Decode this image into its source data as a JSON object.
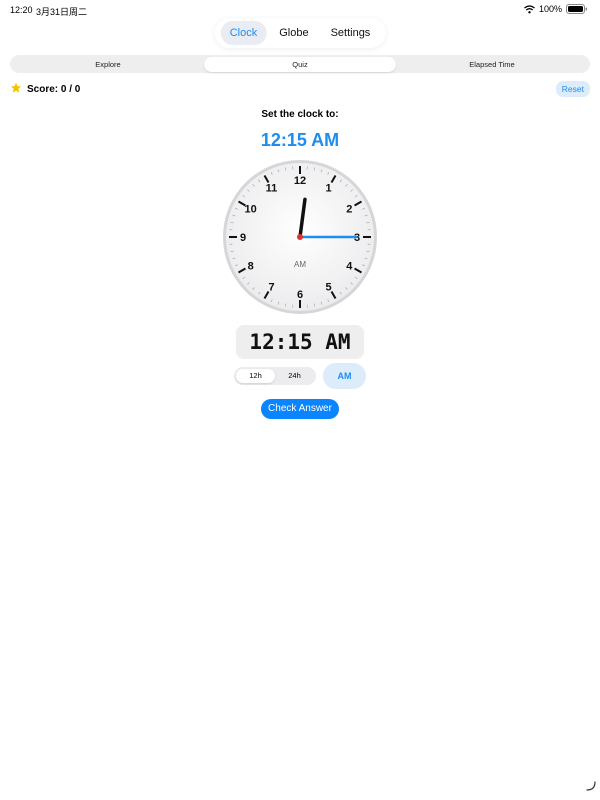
{
  "status_bar": {
    "time": "12:20",
    "date": "3月31日周二",
    "battery": "100%"
  },
  "top_tabs": {
    "items": [
      {
        "label": "Clock",
        "active": true
      },
      {
        "label": "Globe",
        "active": false
      },
      {
        "label": "Settings",
        "active": false
      }
    ]
  },
  "mode_tabs": {
    "items": [
      {
        "label": "Explore",
        "active": false
      },
      {
        "label": "Quiz",
        "active": true
      },
      {
        "label": "Elapsed Time",
        "active": false
      }
    ]
  },
  "score": {
    "label": "Score: 0 / 0",
    "icon": "star-icon"
  },
  "reset_label": "Reset",
  "prompt": "Set the clock to:",
  "target_time": "12:15 AM",
  "clock": {
    "numbers": [
      "12",
      "1",
      "2",
      "3",
      "4",
      "5",
      "6",
      "7",
      "8",
      "9",
      "10",
      "11"
    ],
    "period_label": "AM",
    "hour": 12,
    "minute": 15
  },
  "digital_time": "12:15 AM",
  "format_toggle": {
    "options": [
      {
        "label": "12h",
        "active": true
      },
      {
        "label": "24h",
        "active": false
      }
    ]
  },
  "ampm_button": "AM",
  "check_answer": "Check Answer",
  "colors": {
    "accent": "#1f8cf0",
    "button_blue": "#0a84ff",
    "minute_hand": "#1f8cf0",
    "hour_hand": "#111111",
    "center_dot": "#e03030",
    "star": "#f5c400"
  }
}
